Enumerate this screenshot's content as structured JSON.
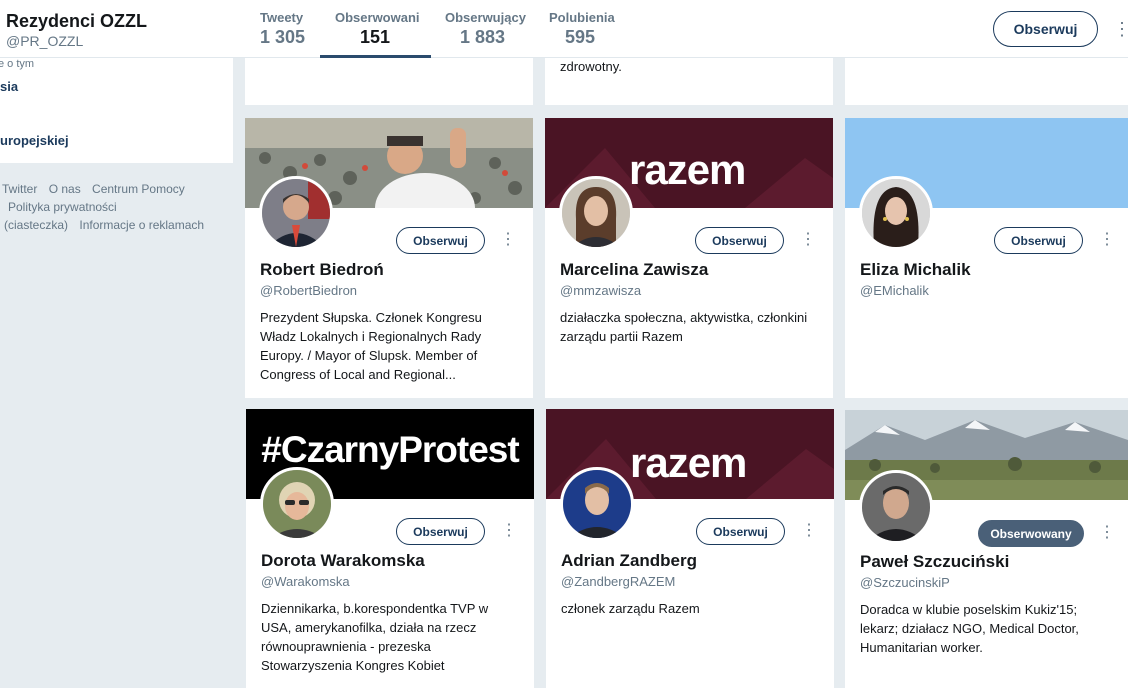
{
  "profile": {
    "name": "Rezydenci OZZL",
    "handle": "@PR_OZZL"
  },
  "stats": [
    {
      "label": "Tweety",
      "value": "1 305"
    },
    {
      "label": "Obserwowani",
      "value": "151"
    },
    {
      "label": "Obserwujący",
      "value": "1 883"
    },
    {
      "label": "Polubienia",
      "value": "595"
    }
  ],
  "topbar": {
    "follow_label": "Obserwuj",
    "more_glyph": "⋮"
  },
  "sidebar": {
    "small_text": "e o tym",
    "link1": "sia",
    "link2": "uropejskiej"
  },
  "footer": {
    "line1": [
      "Twitter",
      "O nas",
      "Centrum Pomocy"
    ],
    "line2": [
      "Polityka prywatności"
    ],
    "line3": [
      "(ciasteczka)",
      "Informacje o reklamach"
    ]
  },
  "top_stub": {
    "text": "zdrowotny."
  },
  "cards": [
    {
      "name": "Robert Biedroń",
      "handle": "@RobertBiedron",
      "button": "Obserwuj",
      "bio": "Prezydent Słupska. Członek Kongresu Władz Lokalnych i Regionalnych Rady Europy. / Mayor of Slupsk. Member of Congress of Local and Regional...",
      "banner_text": ""
    },
    {
      "name": "Marcelina Zawisza",
      "handle": "@mmzawisza",
      "button": "Obserwuj",
      "bio": "działaczka społeczna, aktywistka, członkini zarządu partii Razem",
      "banner_text": "razem"
    },
    {
      "name": "Eliza Michalik",
      "handle": "@EMichalik",
      "button": "Obserwuj",
      "bio": "",
      "banner_text": ""
    },
    {
      "name": "Dorota Warakomska",
      "handle": "@Warakomska",
      "button": "Obserwuj",
      "bio": "Dziennikarka, b.korespondentka TVP w USA, amerykanofilka, działa na rzecz równouprawnienia - prezeska Stowarzyszenia Kongres Kobiet",
      "banner_text": "#CzarnyProtest"
    },
    {
      "name": "Adrian Zandberg",
      "handle": "@ZandbergRAZEM",
      "button": "Obserwuj",
      "bio": "członek zarządu Razem",
      "banner_text": "razem"
    },
    {
      "name": "Paweł Szczuciński",
      "handle": "@SzczucinskiP",
      "button": "Obserwowany",
      "bio": "Doradca w klubie poselskim Kukiz'15; lekarz; działacz NGO, Medical Doctor, Humanitarian worker.",
      "banner_text": ""
    }
  ],
  "colors": {
    "accent": "#1b3a5c",
    "followed": "#4a6078",
    "razem": "#4a1424"
  },
  "icons": {
    "more": "more-vertical-icon"
  }
}
